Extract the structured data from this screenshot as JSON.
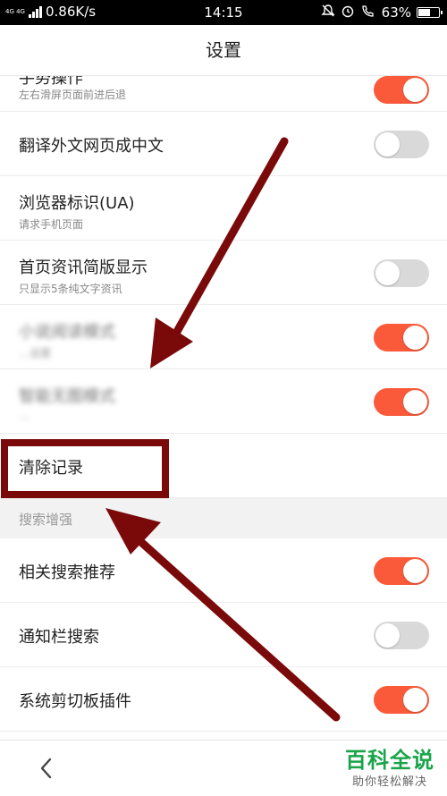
{
  "status_bar": {
    "network_badge": "4G 4G",
    "speed": "0.86K/s",
    "time": "14:15",
    "battery": "63%",
    "battery_level": 0.63
  },
  "header": {
    "title": "设置"
  },
  "settings": {
    "partial": {
      "label": "手势操作",
      "sub": "左右滑屏页面前进后退",
      "on": true
    },
    "translate": {
      "label": "翻译外文网页成中文",
      "on": false
    },
    "ua": {
      "label": "浏览器标识(UA)",
      "sub": "请求手机页面"
    },
    "simple_news": {
      "label": "首页资讯简版显示",
      "sub": "只显示5条纯文字资讯",
      "on": false
    },
    "blurred_1": {
      "label": "小说阅读模式",
      "sub": "…设置",
      "on": true
    },
    "blurred_2": {
      "label": "智能无图模式",
      "sub": "…",
      "on": true
    },
    "clear_history": {
      "label": "清除记录"
    }
  },
  "search_section": {
    "header": "搜索增强",
    "related": {
      "label": "相关搜索推荐",
      "on": true
    },
    "notify": {
      "label": "通知栏搜索",
      "on": false
    },
    "clipboard": {
      "label": "系统剪切板插件",
      "on": true
    }
  },
  "watermark": {
    "title": "百科全说",
    "subtitle": "助你轻松解决"
  },
  "colors": {
    "toggle_on": "#fa5a3a",
    "toggle_off": "#d9d9d9",
    "annotation": "#7a0a0a",
    "watermark": "#1aa44a"
  },
  "icons": {
    "back": "chevron-left-icon"
  }
}
